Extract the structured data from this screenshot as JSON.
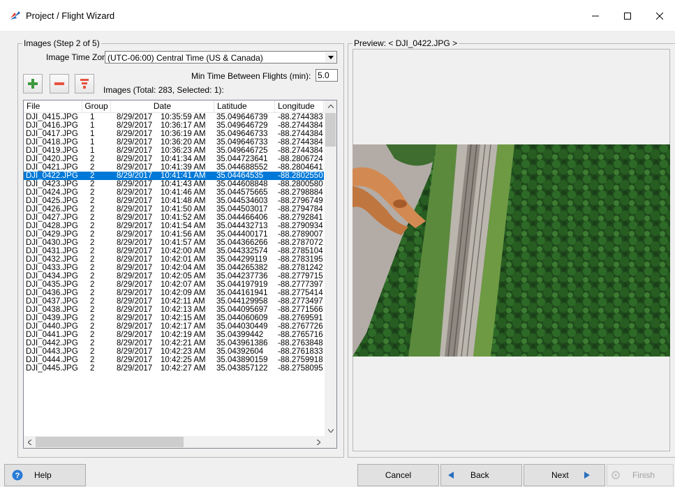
{
  "window": {
    "title": "Project / Flight Wizard"
  },
  "images_group": {
    "legend": "Images (Step 2 of 5)",
    "timezone_label": "Image Time Zone:",
    "timezone_value": "(UTC-06:00) Central Time (US & Canada)",
    "min_time_label": "Min Time Between Flights (min):",
    "min_time_value": "5.0",
    "images_summary": "Images (Total: 283, Selected: 1):"
  },
  "columns": [
    "File",
    "Group",
    "Date",
    "Latitude",
    "Longitude"
  ],
  "rows": [
    [
      "DJI_0415.JPG",
      "1",
      "8/29/2017",
      "10:35:59 AM",
      "35.049646739",
      "-88.2744383"
    ],
    [
      "DJI_0416.JPG",
      "1",
      "8/29/2017",
      "10:36:17 AM",
      "35.049646729",
      "-88.2744384"
    ],
    [
      "DJI_0417.JPG",
      "1",
      "8/29/2017",
      "10:36:19 AM",
      "35.049646733",
      "-88.2744384"
    ],
    [
      "DJI_0418.JPG",
      "1",
      "8/29/2017",
      "10:36:20 AM",
      "35.049646733",
      "-88.2744384"
    ],
    [
      "DJI_0419.JPG",
      "1",
      "8/29/2017",
      "10:36:23 AM",
      "35.049646725",
      "-88.2744384"
    ],
    [
      "DJI_0420.JPG",
      "2",
      "8/29/2017",
      "10:41:34 AM",
      "35.044723641",
      "-88.2806724"
    ],
    [
      "DJI_0421.JPG",
      "2",
      "8/29/2017",
      "10:41:39 AM",
      "35.044688552",
      "-88.2804641"
    ],
    [
      "DJI_0422.JPG",
      "2",
      "8/29/2017",
      "10:41:41 AM",
      "35.04464535",
      "-88.2802550"
    ],
    [
      "DJI_0423.JPG",
      "2",
      "8/29/2017",
      "10:41:43 AM",
      "35.044608848",
      "-88.2800580"
    ],
    [
      "DJI_0424.JPG",
      "2",
      "8/29/2017",
      "10:41:46 AM",
      "35.044575665",
      "-88.2798884"
    ],
    [
      "DJI_0425.JPG",
      "2",
      "8/29/2017",
      "10:41:48 AM",
      "35.044534603",
      "-88.2796749"
    ],
    [
      "DJI_0426.JPG",
      "2",
      "8/29/2017",
      "10:41:50 AM",
      "35.044503017",
      "-88.2794784"
    ],
    [
      "DJI_0427.JPG",
      "2",
      "8/29/2017",
      "10:41:52 AM",
      "35.044466406",
      "-88.2792841"
    ],
    [
      "DJI_0428.JPG",
      "2",
      "8/29/2017",
      "10:41:54 AM",
      "35.044432713",
      "-88.2790934"
    ],
    [
      "DJI_0429.JPG",
      "2",
      "8/29/2017",
      "10:41:56 AM",
      "35.044400171",
      "-88.2789007"
    ],
    [
      "DJI_0430.JPG",
      "2",
      "8/29/2017",
      "10:41:57 AM",
      "35.044366266",
      "-88.2787072"
    ],
    [
      "DJI_0431.JPG",
      "2",
      "8/29/2017",
      "10:42:00 AM",
      "35.044332574",
      "-88.2785104"
    ],
    [
      "DJI_0432.JPG",
      "2",
      "8/29/2017",
      "10:42:01 AM",
      "35.044299119",
      "-88.2783195"
    ],
    [
      "DJI_0433.JPG",
      "2",
      "8/29/2017",
      "10:42:04 AM",
      "35.044265382",
      "-88.2781242"
    ],
    [
      "DJI_0434.JPG",
      "2",
      "8/29/2017",
      "10:42:05 AM",
      "35.044237736",
      "-88.2779715"
    ],
    [
      "DJI_0435.JPG",
      "2",
      "8/29/2017",
      "10:42:07 AM",
      "35.044197919",
      "-88.2777397"
    ],
    [
      "DJI_0436.JPG",
      "2",
      "8/29/2017",
      "10:42:09 AM",
      "35.044161941",
      "-88.2775414"
    ],
    [
      "DJI_0437.JPG",
      "2",
      "8/29/2017",
      "10:42:11 AM",
      "35.044129958",
      "-88.2773497"
    ],
    [
      "DJI_0438.JPG",
      "2",
      "8/29/2017",
      "10:42:13 AM",
      "35.044095697",
      "-88.2771566"
    ],
    [
      "DJI_0439.JPG",
      "2",
      "8/29/2017",
      "10:42:15 AM",
      "35.044060609",
      "-88.2769591"
    ],
    [
      "DJI_0440.JPG",
      "2",
      "8/29/2017",
      "10:42:17 AM",
      "35.044030449",
      "-88.2767726"
    ],
    [
      "DJI_0441.JPG",
      "2",
      "8/29/2017",
      "10:42:19 AM",
      "35.04399442",
      "-88.2765716"
    ],
    [
      "DJI_0442.JPG",
      "2",
      "8/29/2017",
      "10:42:21 AM",
      "35.043961386",
      "-88.2763848"
    ],
    [
      "DJI_0443.JPG",
      "2",
      "8/29/2017",
      "10:42:23 AM",
      "35.04392604",
      "-88.2761833"
    ],
    [
      "DJI_0444.JPG",
      "2",
      "8/29/2017",
      "10:42:25 AM",
      "35.043890159",
      "-88.2759918"
    ],
    [
      "DJI_0445.JPG",
      "2",
      "8/29/2017",
      "10:42:27 AM",
      "35.043857122",
      "-88.2758095"
    ]
  ],
  "selected_index": 7,
  "preview": {
    "label": "Preview: < DJI_0422.JPG >"
  },
  "buttons": {
    "help": "Help",
    "cancel": "Cancel",
    "back": "Back",
    "next": "Next",
    "finish": "Finish"
  },
  "colors": {
    "selection": "#0078d7",
    "add": "#3c9a3c",
    "remove": "#e5533d",
    "filter": "#e5533d"
  },
  "icons": {
    "add": "plus-icon",
    "remove": "minus-icon",
    "filter": "filter-icon",
    "help": "help-icon",
    "back": "triangle-left-icon",
    "next": "triangle-right-icon"
  }
}
